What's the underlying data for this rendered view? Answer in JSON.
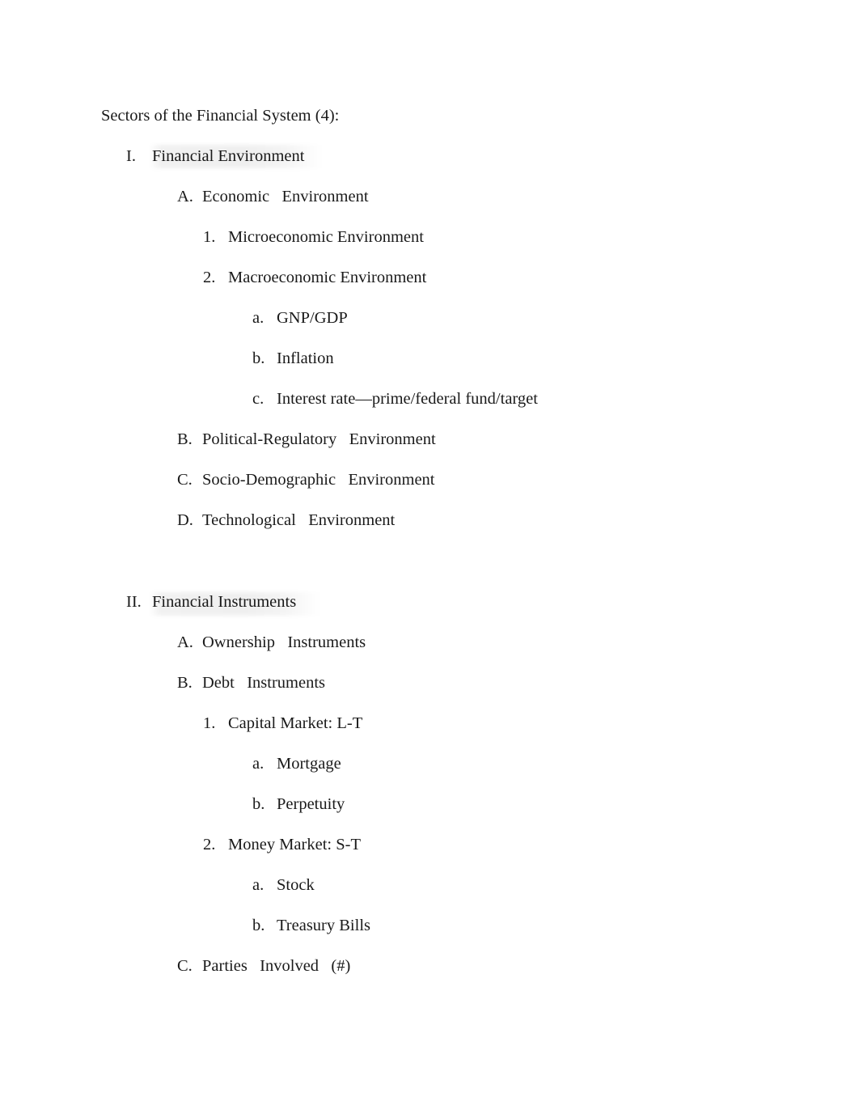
{
  "document": {
    "title": "Sectors of the Financial System (4):",
    "outline": [
      {
        "level": 1,
        "marker": "I.",
        "text": "Financial Environment",
        "highlighted": true
      },
      {
        "level": 2,
        "marker": "A.",
        "text": "Economic   Environment"
      },
      {
        "level": 3,
        "marker": "1.",
        "text": "Microeconomic Environment"
      },
      {
        "level": 3,
        "marker": "2.",
        "text": "Macroeconomic Environment"
      },
      {
        "level": 4,
        "marker": "a.",
        "text": "GNP/GDP"
      },
      {
        "level": 4,
        "marker": "b.",
        "text": "Inflation"
      },
      {
        "level": 4,
        "marker": "c.",
        "text": "Interest rate—prime/federal fund/target"
      },
      {
        "level": 2,
        "marker": "B.",
        "text": "Political-Regulatory   Environment"
      },
      {
        "level": 2,
        "marker": "C.",
        "text": "Socio-Demographic   Environment"
      },
      {
        "level": 2,
        "marker": "D.",
        "text": "Technological   Environment"
      },
      {
        "level": 1,
        "marker": "II.",
        "text": "Financial Instruments",
        "highlighted": true
      },
      {
        "level": 2,
        "marker": "A.",
        "text": "Ownership   Instruments"
      },
      {
        "level": 2,
        "marker": "B.",
        "text": "Debt   Instruments"
      },
      {
        "level": 3,
        "marker": "1.",
        "text": "Capital Market: L-T"
      },
      {
        "level": 4,
        "marker": "a.",
        "text": "Mortgage"
      },
      {
        "level": 4,
        "marker": "b.",
        "text": "Perpetuity"
      },
      {
        "level": 3,
        "marker": "2.",
        "text": "Money Market: S-T"
      },
      {
        "level": 4,
        "marker": "a.",
        "text": "Stock"
      },
      {
        "level": 4,
        "marker": "b.",
        "text": "Treasury Bills"
      },
      {
        "level": 2,
        "marker": "C.",
        "text": "Parties   Involved   (#)"
      }
    ]
  },
  "colors": {
    "page_background": "#ffffff",
    "text": "#1a1a1a",
    "highlight_smudge": "#ebebeb"
  }
}
